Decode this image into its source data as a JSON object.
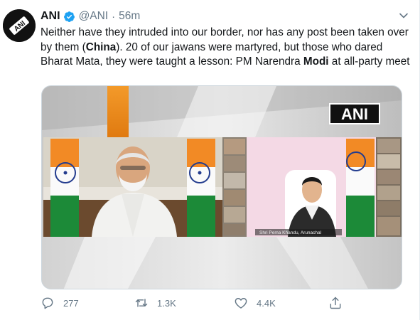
{
  "tweet": {
    "author": {
      "display_name": "ANI",
      "handle": "@ANI",
      "verified": true,
      "avatar_text": "ANI"
    },
    "separator": "·",
    "timestamp": "56m",
    "text_segments": [
      {
        "text": "Neither have they intruded into our border, nor has any post been taken over by them (",
        "bold": false
      },
      {
        "text": "China",
        "bold": true
      },
      {
        "text": "). 20 of our jawans were martyred, but those who dared Bharat Mata, they were taught a lesson: PM Narendra ",
        "bold": false
      },
      {
        "text": "Modi",
        "bold": true
      },
      {
        "text": " at all-party meet",
        "bold": false
      }
    ],
    "media": {
      "watermark": "ANI",
      "caption_strip": "Shri Pema Khandu, Arunachal"
    },
    "actions": {
      "reply": {
        "icon": "reply-icon",
        "count": "277"
      },
      "retweet": {
        "icon": "retweet-icon",
        "count": "1.3K"
      },
      "like": {
        "icon": "heart-icon",
        "count": "4.4K"
      },
      "share": {
        "icon": "share-icon",
        "count": ""
      }
    },
    "colors": {
      "verified_blue": "#1da1f2",
      "meta_grey": "#657786",
      "text": "#14171a"
    }
  }
}
